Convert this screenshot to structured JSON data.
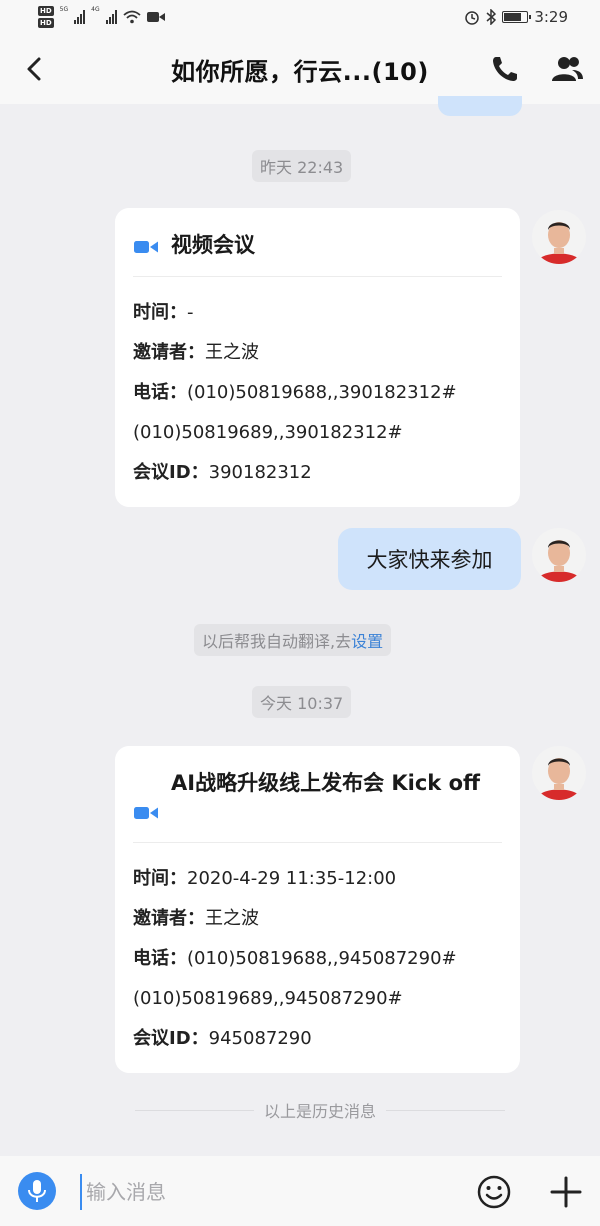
{
  "status_bar": {
    "network_labels": [
      "5G",
      "4G"
    ],
    "time": "3:29"
  },
  "header": {
    "title": "如你所愿，行云...(10)",
    "icons": [
      "back-icon",
      "phone-icon",
      "members-icon"
    ]
  },
  "messages": {
    "timestamp_1": "昨天 22:43",
    "card_1": {
      "title": "视频会议",
      "time_label": "时间：",
      "time_value": "-",
      "inviter_label": "邀请者：",
      "inviter_value": "王之波",
      "phone_label": "电话：",
      "phone_1": "(010)50819688,,390182312#",
      "phone_2": "(010)50819689,,390182312#",
      "meeting_id_label": "会议ID：",
      "meeting_id": "390182312"
    },
    "my_message": "大家快来参加",
    "system_note_prefix": "以后帮我自动翻译,去",
    "system_note_link": "设置",
    "timestamp_2": "今天 10:37",
    "card_2": {
      "title": "AI战略升级线上发布会 Kick off",
      "time_label": "时间：",
      "time_value": "2020-4-29 11:35-12:00",
      "inviter_label": "邀请者：",
      "inviter_value": "王之波",
      "phone_label": "电话：",
      "phone_1": "(010)50819688,,945087290#",
      "phone_2": "(010)50819689,,945087290#",
      "meeting_id_label": "会议ID：",
      "meeting_id": "945087290"
    },
    "history_divider": "以上是历史消息"
  },
  "input_bar": {
    "placeholder": "输入消息",
    "icons": [
      "mic-icon",
      "emoji-icon",
      "plus-icon"
    ]
  },
  "colors": {
    "accent": "#3a8cf0",
    "bubble_mine": "#cfe3fb",
    "background": "#efeff2",
    "link": "#3b82d6"
  }
}
